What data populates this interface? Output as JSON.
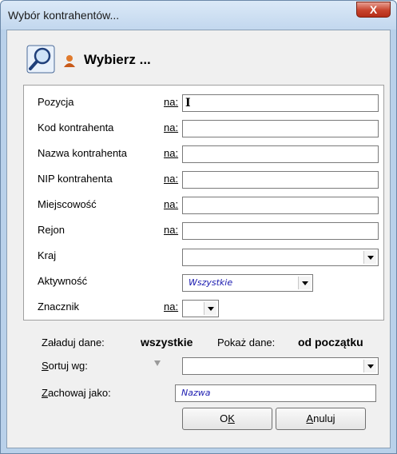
{
  "window": {
    "title": "Wybór kontrahentów...",
    "close_label": "X"
  },
  "header": {
    "title": "Wybierz ..."
  },
  "fields": [
    {
      "label": "Pozycja",
      "na": "na:",
      "value": ""
    },
    {
      "label": "Kod kontrahenta",
      "na": "na:",
      "value": ""
    },
    {
      "label": "Nazwa kontrahenta",
      "na": "na:",
      "value": ""
    },
    {
      "label": "NIP kontrahenta",
      "na": "na:",
      "value": ""
    },
    {
      "label": "Miejscowość",
      "na": "na:",
      "value": ""
    },
    {
      "label": "Rejon",
      "na": "na:",
      "value": ""
    }
  ],
  "kraj": {
    "label": "Kraj",
    "value": ""
  },
  "aktywnosc": {
    "label": "Aktywność",
    "value": "Wszystkie"
  },
  "znacznik": {
    "label": "Znacznik",
    "na": "na:",
    "value": ""
  },
  "load": {
    "label": "Załaduj dane:",
    "value": "wszystkie"
  },
  "show": {
    "label": "Pokaż dane:",
    "value": "od początku"
  },
  "sort": {
    "label_first": "S",
    "label_rest": "ortuj wg:",
    "value": ""
  },
  "save_as": {
    "label_first": "Z",
    "label_rest": "achowaj jako:",
    "value": "Nazwa"
  },
  "buttons": {
    "ok_a": "O",
    "ok_b": "K",
    "cancel_a": "A",
    "cancel_b": "nuluj"
  },
  "colors": {
    "accent_text": "#1a1ab0",
    "close_button": "#c7432c"
  }
}
